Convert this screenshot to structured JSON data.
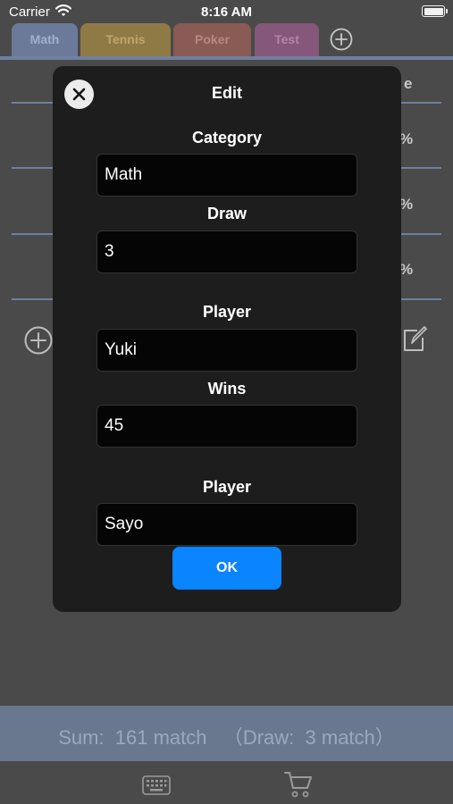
{
  "status_bar": {
    "carrier": "Carrier",
    "time": "8:16 AM"
  },
  "tabs": [
    {
      "label": "Math"
    },
    {
      "label": "Tennis"
    },
    {
      "label": "Poker"
    },
    {
      "label": "Test"
    }
  ],
  "background": {
    "header_fragment": "e",
    "percent_symbols": [
      "%",
      "%",
      "%"
    ]
  },
  "modal": {
    "title": "Edit",
    "fields": [
      {
        "label": "Category",
        "value": "Math"
      },
      {
        "label": "Draw",
        "value": "3"
      },
      {
        "label": "Player",
        "value": "Yuki"
      },
      {
        "label": "Wins",
        "value": "45"
      },
      {
        "label": "Player",
        "value": "Sayo"
      }
    ],
    "ok_label": "OK"
  },
  "summary": {
    "text": "Sum:  161 match   （Draw:  3 match）"
  },
  "colors": {
    "accent": "#0a84ff",
    "tab_math": "#6c7a99",
    "tab_tennis": "#8f7a46",
    "tab_poker": "#8a5a55",
    "tab_test": "#85577a",
    "modal_bg": "#1d1d1d"
  },
  "icons": [
    "wifi-icon",
    "battery-icon",
    "add-tab-icon",
    "close-icon",
    "add-row-icon",
    "edit-icon",
    "keyboard-icon",
    "cart-icon"
  ]
}
